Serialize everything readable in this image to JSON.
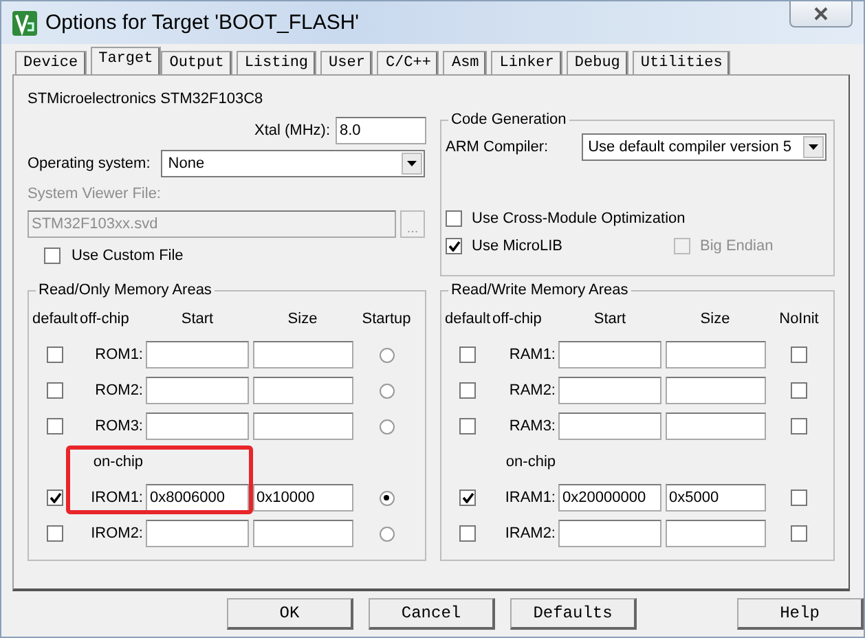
{
  "window": {
    "title": "Options for Target 'BOOT_FLASH'"
  },
  "tabs": [
    {
      "label": "Device",
      "selected": false
    },
    {
      "label": "Target",
      "selected": true
    },
    {
      "label": "Output",
      "selected": false
    },
    {
      "label": "Listing",
      "selected": false
    },
    {
      "label": "User",
      "selected": false
    },
    {
      "label": "C/C++",
      "selected": false
    },
    {
      "label": "Asm",
      "selected": false
    },
    {
      "label": "Linker",
      "selected": false
    },
    {
      "label": "Debug",
      "selected": false
    },
    {
      "label": "Utilities",
      "selected": false
    }
  ],
  "device": "STMicroelectronics STM32F103C8",
  "xtal": {
    "label": "Xtal (MHz):",
    "value": "8.0"
  },
  "operating_system": {
    "label": "Operating system:",
    "value": "None"
  },
  "system_viewer": {
    "label": "System Viewer File:",
    "value": "STM32F103xx.svd",
    "disabled": true,
    "browse": "...",
    "use_custom": {
      "label": "Use Custom File",
      "checked": false
    }
  },
  "code_generation": {
    "title": "Code Generation",
    "compiler_label": "ARM Compiler:",
    "compiler": "Use default compiler version 5",
    "options": [
      {
        "label": "Use Cross-Module Optimization",
        "checked": false,
        "disabled": false
      },
      {
        "label": "Use MicroLIB",
        "checked": true,
        "disabled": false
      },
      {
        "label": "Big Endian",
        "checked": false,
        "disabled": true
      }
    ]
  },
  "memory_areas": [
    {
      "title": "Read/Only Memory Areas",
      "kind": "radio",
      "columns": [
        "default",
        "off-chip",
        "Start",
        "Size",
        "Startup"
      ],
      "rows": [
        {
          "kind": "memory",
          "label": "ROM1:",
          "default": false,
          "start": "",
          "size": "",
          "flag": false
        },
        {
          "kind": "memory",
          "label": "ROM2:",
          "default": false,
          "start": "",
          "size": "",
          "flag": false
        },
        {
          "kind": "memory",
          "label": "ROM3:",
          "default": false,
          "start": "",
          "size": "",
          "flag": false
        },
        {
          "kind": "heading",
          "label": "on-chip"
        },
        {
          "kind": "memory",
          "label": "IROM1:",
          "default": true,
          "start": "0x8006000",
          "size": "0x10000",
          "flag": true
        },
        {
          "kind": "memory",
          "label": "IROM2:",
          "default": false,
          "start": "",
          "size": "",
          "flag": false
        }
      ]
    },
    {
      "title": "Read/Write Memory Areas",
      "kind": "checkbox",
      "columns": [
        "default",
        "off-chip",
        "Start",
        "Size",
        "NoInit"
      ],
      "rows": [
        {
          "kind": "memory",
          "label": "RAM1:",
          "default": false,
          "start": "",
          "size": "",
          "flag": false
        },
        {
          "kind": "memory",
          "label": "RAM2:",
          "default": false,
          "start": "",
          "size": "",
          "flag": false
        },
        {
          "kind": "memory",
          "label": "RAM3:",
          "default": false,
          "start": "",
          "size": "",
          "flag": false
        },
        {
          "kind": "heading",
          "label": "on-chip"
        },
        {
          "kind": "memory",
          "label": "IRAM1:",
          "default": true,
          "start": "0x20000000",
          "size": "0x5000",
          "flag": false
        },
        {
          "kind": "memory",
          "label": "IRAM2:",
          "default": false,
          "start": "",
          "size": "",
          "flag": false
        }
      ]
    }
  ],
  "buttons": [
    "OK",
    "Cancel",
    "Defaults",
    "Help"
  ]
}
